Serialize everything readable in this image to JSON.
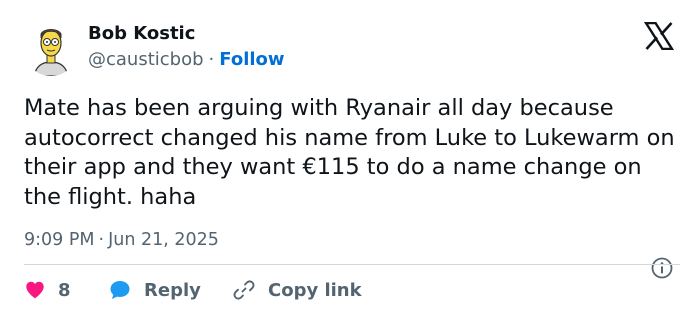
{
  "author": {
    "display_name": "Bob Kostic",
    "handle": "@causticbob",
    "separator": "·",
    "follow_label": "Follow",
    "avatar_icon": "cartoon-avatar"
  },
  "platform": {
    "logo_icon": "x-logo"
  },
  "tweet": {
    "text": "Mate has been arguing with Ryanair all day because autocorrect changed his name from Luke to Lukewarm on their app and they want €115 to do a name change on the flight. haha",
    "time": "9:09 PM",
    "meta_separator": "·",
    "date": "Jun 21, 2025",
    "info_icon": "info-icon"
  },
  "actions": {
    "like_count": "8",
    "like_icon": "heart-icon",
    "reply_label": "Reply",
    "reply_icon": "speech-bubble-icon",
    "copy_label": "Copy link",
    "copy_icon": "link-icon"
  },
  "colors": {
    "text": "#0f1419",
    "secondary": "#536471",
    "link": "#006fd6",
    "like": "#f91880",
    "reply": "#1d9bf0",
    "divider": "#cfd9de"
  }
}
